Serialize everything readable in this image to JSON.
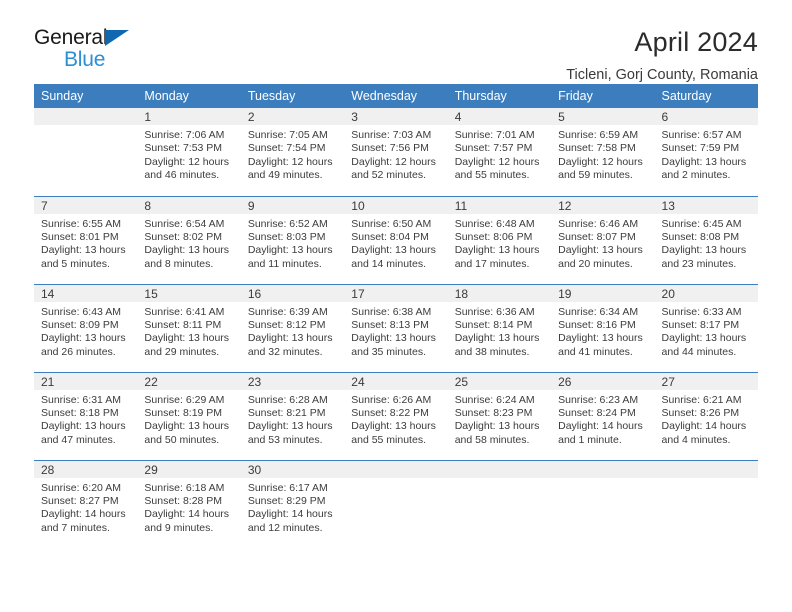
{
  "brand": {
    "name_top": "General",
    "name_bottom": "Blue",
    "accent_dark": "#1068b0",
    "accent_light": "#2b8fd6"
  },
  "header": {
    "title": "April 2024",
    "subtitle": "Ticleni, Gorj County, Romania",
    "header_bg": "#3b7dbd",
    "daynum_bg": "#f0f0f0"
  },
  "weekday_headers": [
    "Sunday",
    "Monday",
    "Tuesday",
    "Wednesday",
    "Thursday",
    "Friday",
    "Saturday"
  ],
  "weeks": [
    [
      {
        "day": "",
        "sunrise": "",
        "sunset": "",
        "daylight": ""
      },
      {
        "day": "1",
        "sunrise": "Sunrise: 7:06 AM",
        "sunset": "Sunset: 7:53 PM",
        "daylight": "Daylight: 12 hours and 46 minutes."
      },
      {
        "day": "2",
        "sunrise": "Sunrise: 7:05 AM",
        "sunset": "Sunset: 7:54 PM",
        "daylight": "Daylight: 12 hours and 49 minutes."
      },
      {
        "day": "3",
        "sunrise": "Sunrise: 7:03 AM",
        "sunset": "Sunset: 7:56 PM",
        "daylight": "Daylight: 12 hours and 52 minutes."
      },
      {
        "day": "4",
        "sunrise": "Sunrise: 7:01 AM",
        "sunset": "Sunset: 7:57 PM",
        "daylight": "Daylight: 12 hours and 55 minutes."
      },
      {
        "day": "5",
        "sunrise": "Sunrise: 6:59 AM",
        "sunset": "Sunset: 7:58 PM",
        "daylight": "Daylight: 12 hours and 59 minutes."
      },
      {
        "day": "6",
        "sunrise": "Sunrise: 6:57 AM",
        "sunset": "Sunset: 7:59 PM",
        "daylight": "Daylight: 13 hours and 2 minutes."
      }
    ],
    [
      {
        "day": "7",
        "sunrise": "Sunrise: 6:55 AM",
        "sunset": "Sunset: 8:01 PM",
        "daylight": "Daylight: 13 hours and 5 minutes."
      },
      {
        "day": "8",
        "sunrise": "Sunrise: 6:54 AM",
        "sunset": "Sunset: 8:02 PM",
        "daylight": "Daylight: 13 hours and 8 minutes."
      },
      {
        "day": "9",
        "sunrise": "Sunrise: 6:52 AM",
        "sunset": "Sunset: 8:03 PM",
        "daylight": "Daylight: 13 hours and 11 minutes."
      },
      {
        "day": "10",
        "sunrise": "Sunrise: 6:50 AM",
        "sunset": "Sunset: 8:04 PM",
        "daylight": "Daylight: 13 hours and 14 minutes."
      },
      {
        "day": "11",
        "sunrise": "Sunrise: 6:48 AM",
        "sunset": "Sunset: 8:06 PM",
        "daylight": "Daylight: 13 hours and 17 minutes."
      },
      {
        "day": "12",
        "sunrise": "Sunrise: 6:46 AM",
        "sunset": "Sunset: 8:07 PM",
        "daylight": "Daylight: 13 hours and 20 minutes."
      },
      {
        "day": "13",
        "sunrise": "Sunrise: 6:45 AM",
        "sunset": "Sunset: 8:08 PM",
        "daylight": "Daylight: 13 hours and 23 minutes."
      }
    ],
    [
      {
        "day": "14",
        "sunrise": "Sunrise: 6:43 AM",
        "sunset": "Sunset: 8:09 PM",
        "daylight": "Daylight: 13 hours and 26 minutes."
      },
      {
        "day": "15",
        "sunrise": "Sunrise: 6:41 AM",
        "sunset": "Sunset: 8:11 PM",
        "daylight": "Daylight: 13 hours and 29 minutes."
      },
      {
        "day": "16",
        "sunrise": "Sunrise: 6:39 AM",
        "sunset": "Sunset: 8:12 PM",
        "daylight": "Daylight: 13 hours and 32 minutes."
      },
      {
        "day": "17",
        "sunrise": "Sunrise: 6:38 AM",
        "sunset": "Sunset: 8:13 PM",
        "daylight": "Daylight: 13 hours and 35 minutes."
      },
      {
        "day": "18",
        "sunrise": "Sunrise: 6:36 AM",
        "sunset": "Sunset: 8:14 PM",
        "daylight": "Daylight: 13 hours and 38 minutes."
      },
      {
        "day": "19",
        "sunrise": "Sunrise: 6:34 AM",
        "sunset": "Sunset: 8:16 PM",
        "daylight": "Daylight: 13 hours and 41 minutes."
      },
      {
        "day": "20",
        "sunrise": "Sunrise: 6:33 AM",
        "sunset": "Sunset: 8:17 PM",
        "daylight": "Daylight: 13 hours and 44 minutes."
      }
    ],
    [
      {
        "day": "21",
        "sunrise": "Sunrise: 6:31 AM",
        "sunset": "Sunset: 8:18 PM",
        "daylight": "Daylight: 13 hours and 47 minutes."
      },
      {
        "day": "22",
        "sunrise": "Sunrise: 6:29 AM",
        "sunset": "Sunset: 8:19 PM",
        "daylight": "Daylight: 13 hours and 50 minutes."
      },
      {
        "day": "23",
        "sunrise": "Sunrise: 6:28 AM",
        "sunset": "Sunset: 8:21 PM",
        "daylight": "Daylight: 13 hours and 53 minutes."
      },
      {
        "day": "24",
        "sunrise": "Sunrise: 6:26 AM",
        "sunset": "Sunset: 8:22 PM",
        "daylight": "Daylight: 13 hours and 55 minutes."
      },
      {
        "day": "25",
        "sunrise": "Sunrise: 6:24 AM",
        "sunset": "Sunset: 8:23 PM",
        "daylight": "Daylight: 13 hours and 58 minutes."
      },
      {
        "day": "26",
        "sunrise": "Sunrise: 6:23 AM",
        "sunset": "Sunset: 8:24 PM",
        "daylight": "Daylight: 14 hours and 1 minute."
      },
      {
        "day": "27",
        "sunrise": "Sunrise: 6:21 AM",
        "sunset": "Sunset: 8:26 PM",
        "daylight": "Daylight: 14 hours and 4 minutes."
      }
    ],
    [
      {
        "day": "28",
        "sunrise": "Sunrise: 6:20 AM",
        "sunset": "Sunset: 8:27 PM",
        "daylight": "Daylight: 14 hours and 7 minutes."
      },
      {
        "day": "29",
        "sunrise": "Sunrise: 6:18 AM",
        "sunset": "Sunset: 8:28 PM",
        "daylight": "Daylight: 14 hours and 9 minutes."
      },
      {
        "day": "30",
        "sunrise": "Sunrise: 6:17 AM",
        "sunset": "Sunset: 8:29 PM",
        "daylight": "Daylight: 14 hours and 12 minutes."
      },
      {
        "day": "",
        "sunrise": "",
        "sunset": "",
        "daylight": ""
      },
      {
        "day": "",
        "sunrise": "",
        "sunset": "",
        "daylight": ""
      },
      {
        "day": "",
        "sunrise": "",
        "sunset": "",
        "daylight": ""
      },
      {
        "day": "",
        "sunrise": "",
        "sunset": "",
        "daylight": ""
      }
    ]
  ]
}
